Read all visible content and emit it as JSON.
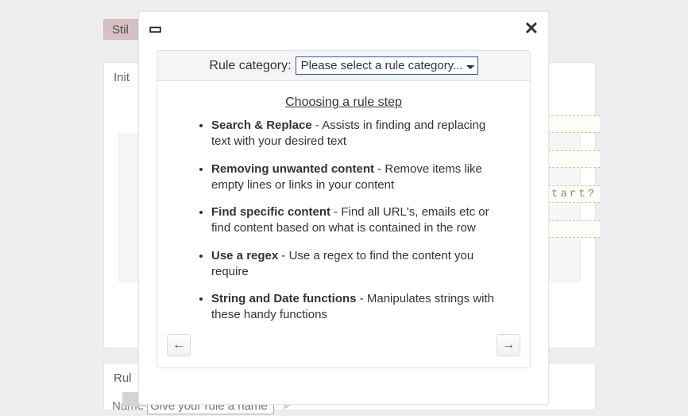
{
  "bg": {
    "still_label": "Stil",
    "init_label": "Init",
    "tart_text": "tart?",
    "rul_label": "Rul",
    "name_label": "Name",
    "name_placeholder": "Give your rule a name"
  },
  "modal": {
    "category_label": "Rule category:",
    "select_placeholder": "Please select a rule category...",
    "step_title": "Choosing a rule step",
    "items": [
      {
        "name": "Search & Replace",
        "desc": "Assists in finding and replacing text with your desired text"
      },
      {
        "name": "Removing unwanted content",
        "desc": "Remove items like empty lines or links in your content"
      },
      {
        "name": "Find specific content",
        "desc": "Find all URL's, emails etc or find content based on what is contained in the row"
      },
      {
        "name": "Use a regex",
        "desc": "Use a regex to find the content you require"
      },
      {
        "name": "String and Date functions",
        "desc": "Manipulates strings with these handy functions"
      }
    ],
    "back_glyph": "←",
    "fwd_glyph": "→",
    "close_glyph": "✕",
    "win_glyph": "▭"
  }
}
